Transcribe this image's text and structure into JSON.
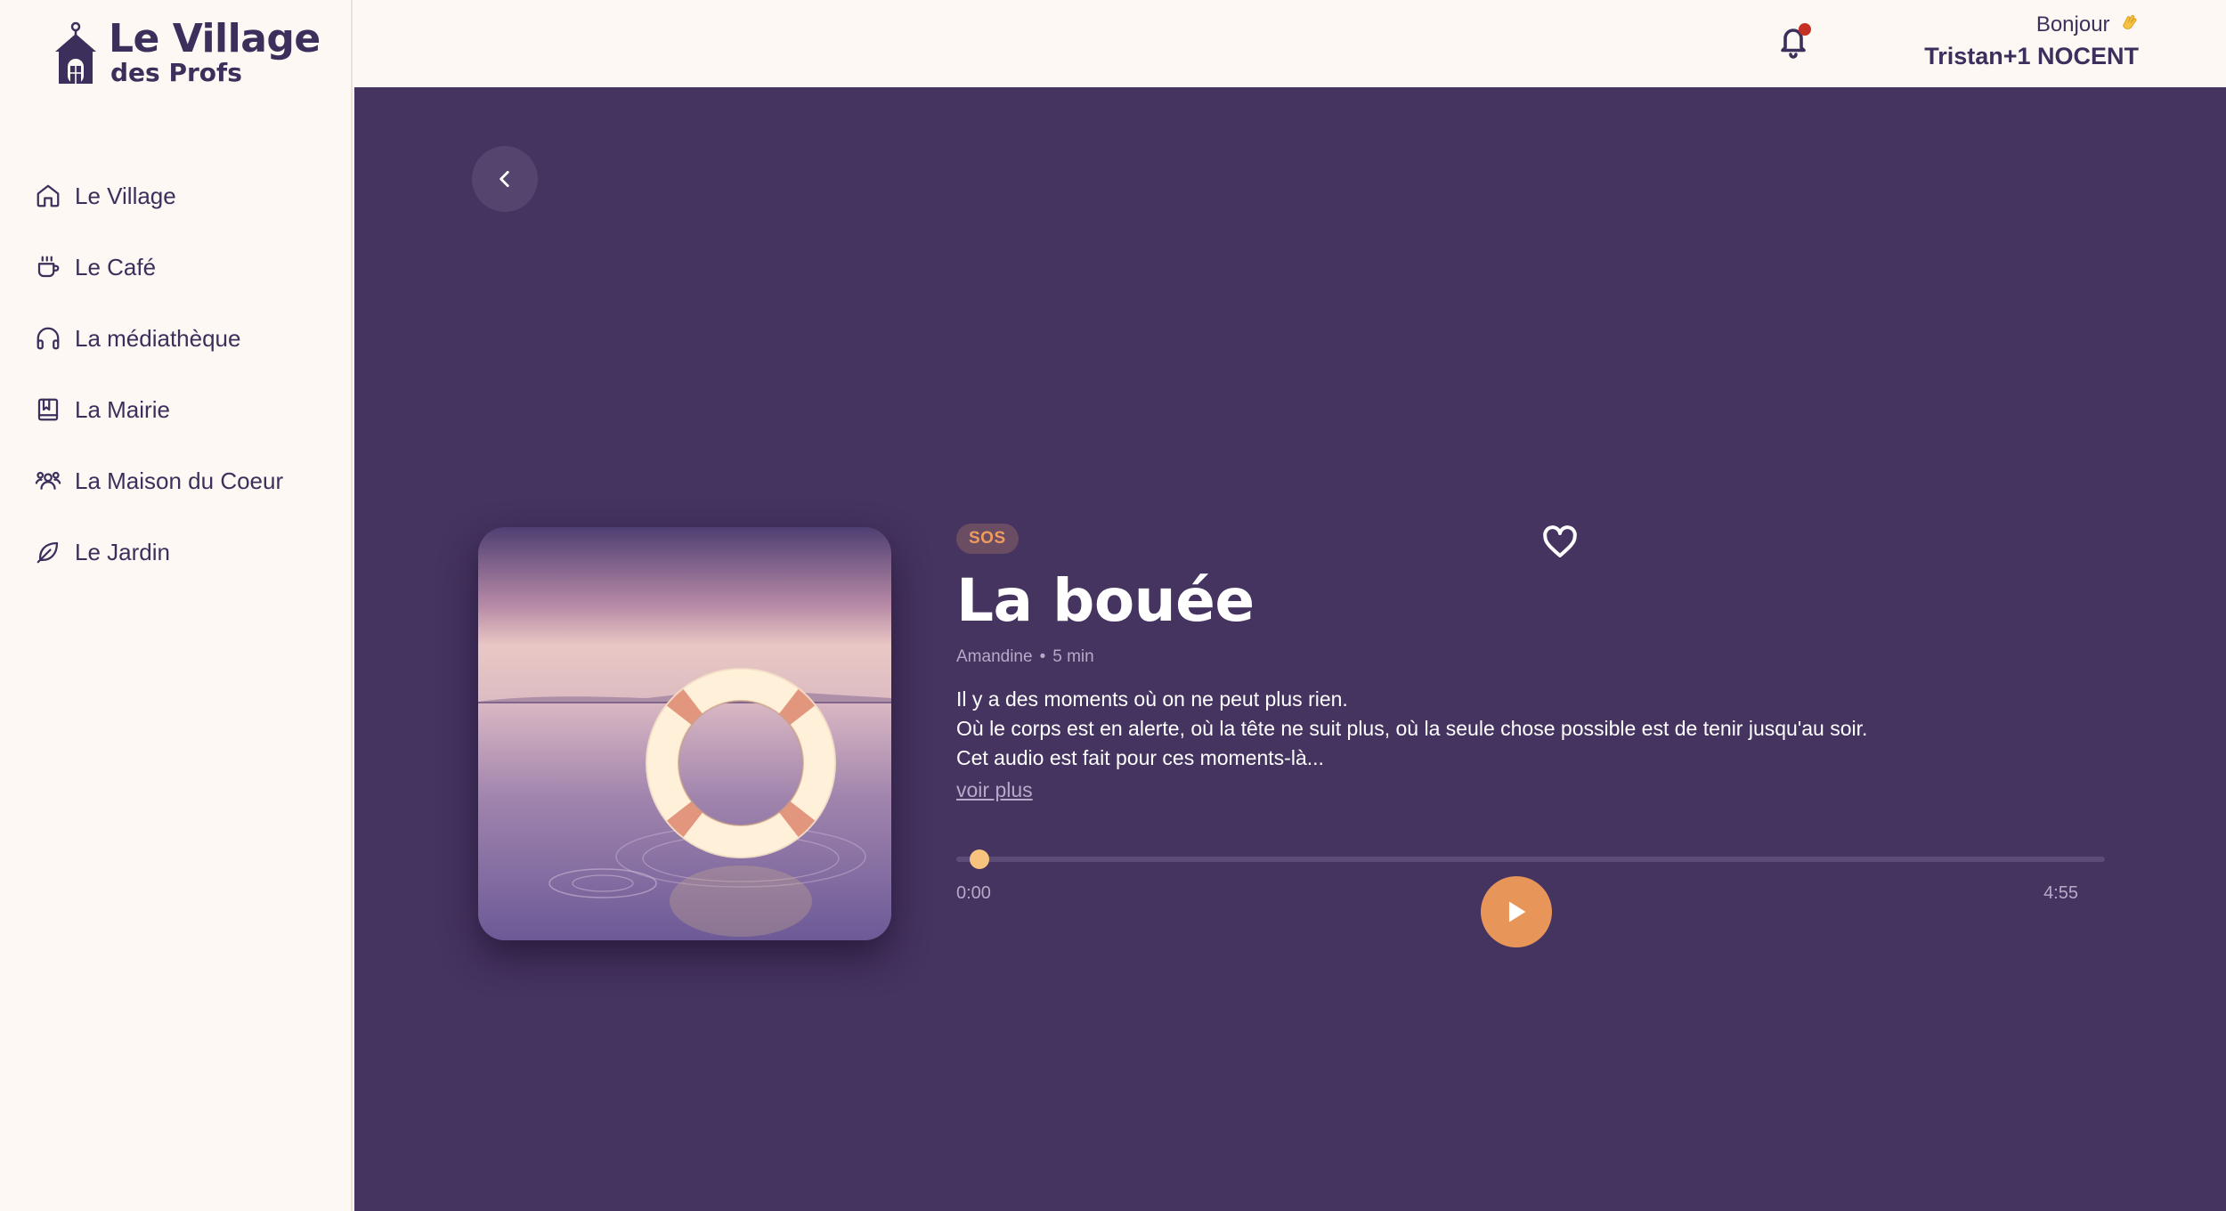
{
  "app": {
    "logo_title": "Le Village",
    "logo_subtitle": "des Profs"
  },
  "sidebar": {
    "items": [
      {
        "label": "Le Village",
        "icon": "home-icon"
      },
      {
        "label": "Le Café",
        "icon": "coffee-cup-icon"
      },
      {
        "label": "La médiathèque",
        "icon": "headphones-icon"
      },
      {
        "label": "La Mairie",
        "icon": "book-icon"
      },
      {
        "label": "La Maison du Coeur",
        "icon": "users-icon"
      },
      {
        "label": "Le Jardin",
        "icon": "leaf-icon"
      }
    ]
  },
  "header": {
    "greeting": "Bonjour",
    "user_name": "Tristan+1 NOCENT",
    "notification_dot_color": "#c62f24"
  },
  "track": {
    "badge": "SOS",
    "title": "La bouée",
    "author": "Amandine",
    "duration_label": "5 min",
    "description": [
      "Il y a des moments où on ne peut plus rien.",
      "Où le corps est en alerte, où la tête ne suit plus, où la seule chose possible est de tenir jusqu'au soir.",
      "Cet audio est fait pour ces moments-là..."
    ],
    "more_link": "voir plus"
  },
  "player": {
    "current_time": "0:00",
    "total_time": "4:55",
    "progress_fraction": 0
  },
  "colors": {
    "main_bg": "#453360",
    "accent": "#e8955a",
    "progress": "#f6c47e",
    "sidebar_bg": "#fdf8f3"
  }
}
